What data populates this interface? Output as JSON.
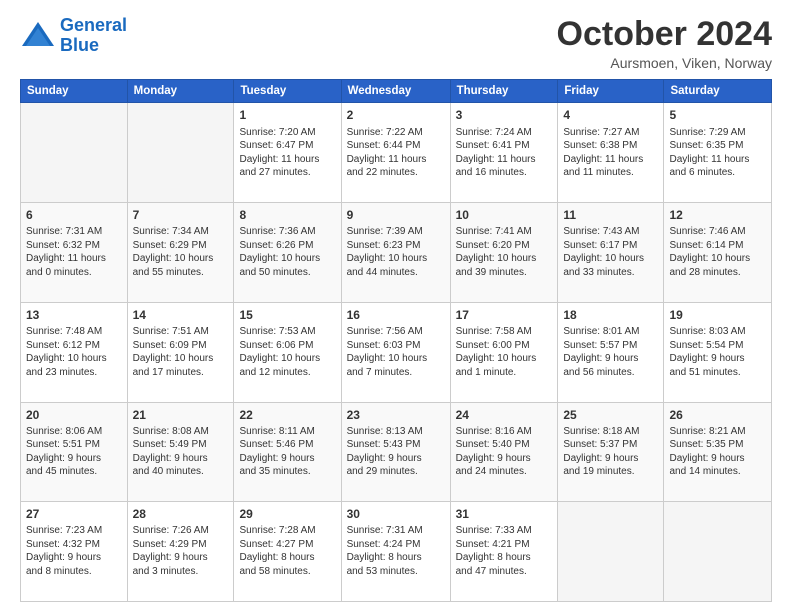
{
  "logo": {
    "line1": "General",
    "line2": "Blue"
  },
  "calendar": {
    "title": "October 2024",
    "subtitle": "Aursmoen, Viken, Norway",
    "headers": [
      "Sunday",
      "Monday",
      "Tuesday",
      "Wednesday",
      "Thursday",
      "Friday",
      "Saturday"
    ],
    "weeks": [
      [
        {
          "day": "",
          "info": ""
        },
        {
          "day": "",
          "info": ""
        },
        {
          "day": "1",
          "info": "Sunrise: 7:20 AM\nSunset: 6:47 PM\nDaylight: 11 hours\nand 27 minutes."
        },
        {
          "day": "2",
          "info": "Sunrise: 7:22 AM\nSunset: 6:44 PM\nDaylight: 11 hours\nand 22 minutes."
        },
        {
          "day": "3",
          "info": "Sunrise: 7:24 AM\nSunset: 6:41 PM\nDaylight: 11 hours\nand 16 minutes."
        },
        {
          "day": "4",
          "info": "Sunrise: 7:27 AM\nSunset: 6:38 PM\nDaylight: 11 hours\nand 11 minutes."
        },
        {
          "day": "5",
          "info": "Sunrise: 7:29 AM\nSunset: 6:35 PM\nDaylight: 11 hours\nand 6 minutes."
        }
      ],
      [
        {
          "day": "6",
          "info": "Sunrise: 7:31 AM\nSunset: 6:32 PM\nDaylight: 11 hours\nand 0 minutes."
        },
        {
          "day": "7",
          "info": "Sunrise: 7:34 AM\nSunset: 6:29 PM\nDaylight: 10 hours\nand 55 minutes."
        },
        {
          "day": "8",
          "info": "Sunrise: 7:36 AM\nSunset: 6:26 PM\nDaylight: 10 hours\nand 50 minutes."
        },
        {
          "day": "9",
          "info": "Sunrise: 7:39 AM\nSunset: 6:23 PM\nDaylight: 10 hours\nand 44 minutes."
        },
        {
          "day": "10",
          "info": "Sunrise: 7:41 AM\nSunset: 6:20 PM\nDaylight: 10 hours\nand 39 minutes."
        },
        {
          "day": "11",
          "info": "Sunrise: 7:43 AM\nSunset: 6:17 PM\nDaylight: 10 hours\nand 33 minutes."
        },
        {
          "day": "12",
          "info": "Sunrise: 7:46 AM\nSunset: 6:14 PM\nDaylight: 10 hours\nand 28 minutes."
        }
      ],
      [
        {
          "day": "13",
          "info": "Sunrise: 7:48 AM\nSunset: 6:12 PM\nDaylight: 10 hours\nand 23 minutes."
        },
        {
          "day": "14",
          "info": "Sunrise: 7:51 AM\nSunset: 6:09 PM\nDaylight: 10 hours\nand 17 minutes."
        },
        {
          "day": "15",
          "info": "Sunrise: 7:53 AM\nSunset: 6:06 PM\nDaylight: 10 hours\nand 12 minutes."
        },
        {
          "day": "16",
          "info": "Sunrise: 7:56 AM\nSunset: 6:03 PM\nDaylight: 10 hours\nand 7 minutes."
        },
        {
          "day": "17",
          "info": "Sunrise: 7:58 AM\nSunset: 6:00 PM\nDaylight: 10 hours\nand 1 minute."
        },
        {
          "day": "18",
          "info": "Sunrise: 8:01 AM\nSunset: 5:57 PM\nDaylight: 9 hours\nand 56 minutes."
        },
        {
          "day": "19",
          "info": "Sunrise: 8:03 AM\nSunset: 5:54 PM\nDaylight: 9 hours\nand 51 minutes."
        }
      ],
      [
        {
          "day": "20",
          "info": "Sunrise: 8:06 AM\nSunset: 5:51 PM\nDaylight: 9 hours\nand 45 minutes."
        },
        {
          "day": "21",
          "info": "Sunrise: 8:08 AM\nSunset: 5:49 PM\nDaylight: 9 hours\nand 40 minutes."
        },
        {
          "day": "22",
          "info": "Sunrise: 8:11 AM\nSunset: 5:46 PM\nDaylight: 9 hours\nand 35 minutes."
        },
        {
          "day": "23",
          "info": "Sunrise: 8:13 AM\nSunset: 5:43 PM\nDaylight: 9 hours\nand 29 minutes."
        },
        {
          "day": "24",
          "info": "Sunrise: 8:16 AM\nSunset: 5:40 PM\nDaylight: 9 hours\nand 24 minutes."
        },
        {
          "day": "25",
          "info": "Sunrise: 8:18 AM\nSunset: 5:37 PM\nDaylight: 9 hours\nand 19 minutes."
        },
        {
          "day": "26",
          "info": "Sunrise: 8:21 AM\nSunset: 5:35 PM\nDaylight: 9 hours\nand 14 minutes."
        }
      ],
      [
        {
          "day": "27",
          "info": "Sunrise: 7:23 AM\nSunset: 4:32 PM\nDaylight: 9 hours\nand 8 minutes."
        },
        {
          "day": "28",
          "info": "Sunrise: 7:26 AM\nSunset: 4:29 PM\nDaylight: 9 hours\nand 3 minutes."
        },
        {
          "day": "29",
          "info": "Sunrise: 7:28 AM\nSunset: 4:27 PM\nDaylight: 8 hours\nand 58 minutes."
        },
        {
          "day": "30",
          "info": "Sunrise: 7:31 AM\nSunset: 4:24 PM\nDaylight: 8 hours\nand 53 minutes."
        },
        {
          "day": "31",
          "info": "Sunrise: 7:33 AM\nSunset: 4:21 PM\nDaylight: 8 hours\nand 47 minutes."
        },
        {
          "day": "",
          "info": ""
        },
        {
          "day": "",
          "info": ""
        }
      ]
    ]
  }
}
